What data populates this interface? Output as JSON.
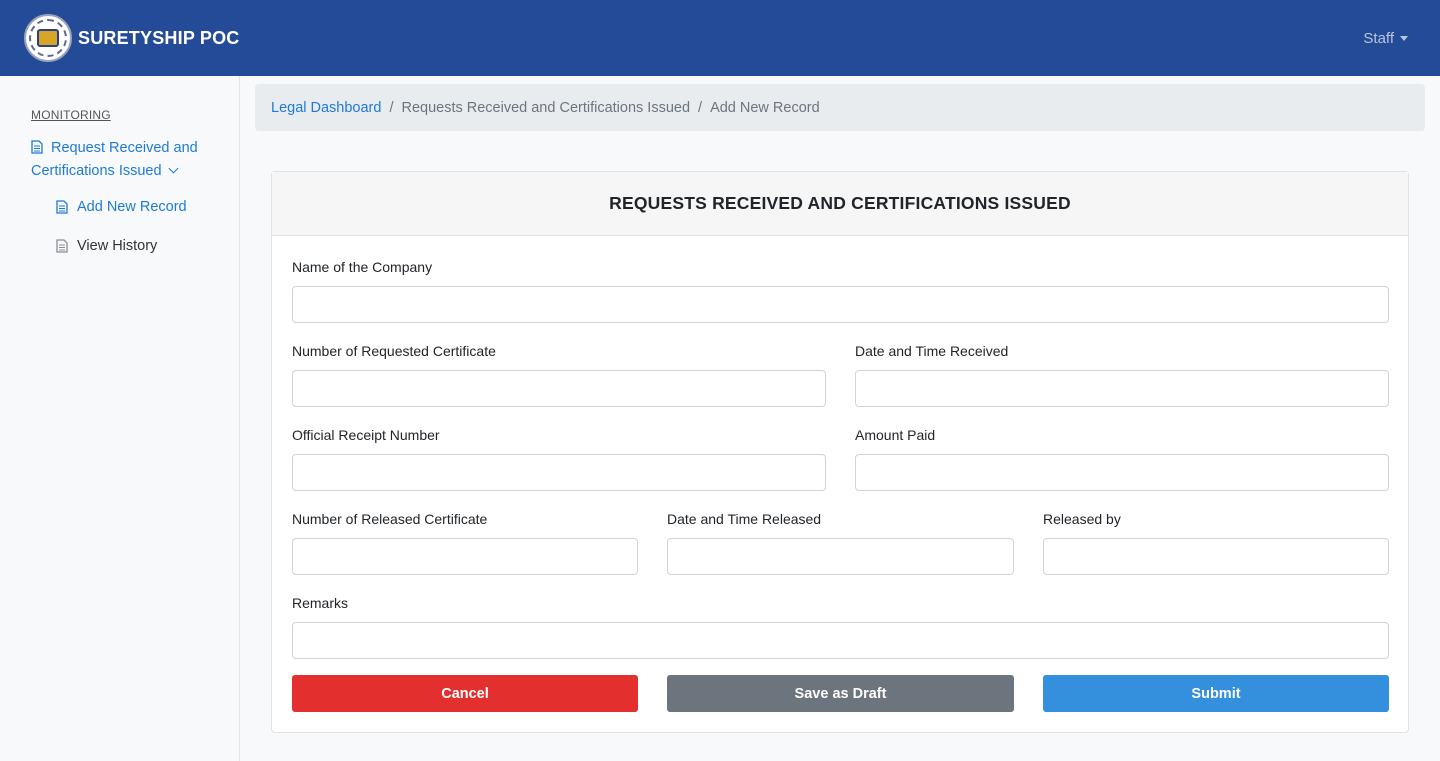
{
  "app": {
    "brand": "SURETYSHIP POC",
    "user_menu_label": "Staff"
  },
  "sidebar": {
    "section_title": "MONITORING",
    "main_item_label": "Request Received and Certifications Issued",
    "sub_items": [
      {
        "label": "Add New Record"
      },
      {
        "label": "View History"
      }
    ]
  },
  "breadcrumb": {
    "items": [
      "Legal Dashboard",
      "Requests Received and Certifications Issued",
      "Add New Record"
    ],
    "separator": "/"
  },
  "form": {
    "title": "REQUESTS RECEIVED AND CERTIFICATIONS ISSUED",
    "fields": {
      "company_name": {
        "label": "Name of the Company",
        "value": ""
      },
      "requested_cert_no": {
        "label": "Number of Requested Certificate",
        "value": ""
      },
      "date_time_received": {
        "label": "Date and Time Received",
        "value": ""
      },
      "official_receipt_no": {
        "label": "Official Receipt Number",
        "value": ""
      },
      "amount_paid": {
        "label": "Amount Paid",
        "value": ""
      },
      "released_cert_no": {
        "label": "Number of Released Certificate",
        "value": ""
      },
      "date_time_released": {
        "label": "Date and Time Released",
        "value": ""
      },
      "released_by": {
        "label": "Released by",
        "value": ""
      },
      "remarks": {
        "label": "Remarks",
        "value": ""
      }
    },
    "buttons": {
      "cancel": "Cancel",
      "save_draft": "Save as Draft",
      "submit": "Submit"
    }
  },
  "colors": {
    "navbar": "#244b97",
    "link": "#1f7ad6",
    "cancel": "#e3302f",
    "draft": "#6c757d",
    "submit": "#3490dc"
  }
}
